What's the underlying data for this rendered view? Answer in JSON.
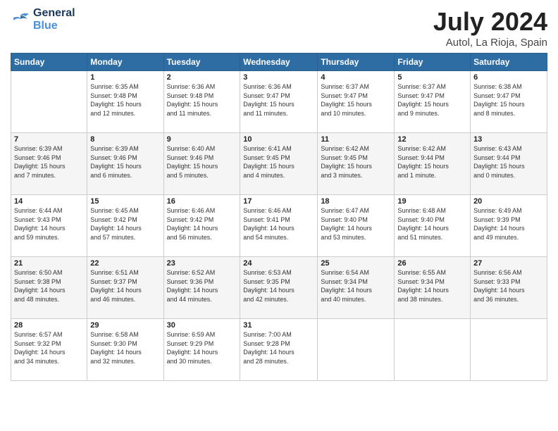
{
  "header": {
    "logo_line1": "General",
    "logo_line2": "Blue",
    "month": "July 2024",
    "location": "Autol, La Rioja, Spain"
  },
  "weekdays": [
    "Sunday",
    "Monday",
    "Tuesday",
    "Wednesday",
    "Thursday",
    "Friday",
    "Saturday"
  ],
  "weeks": [
    [
      {
        "day": "",
        "info": ""
      },
      {
        "day": "1",
        "info": "Sunrise: 6:35 AM\nSunset: 9:48 PM\nDaylight: 15 hours\nand 12 minutes."
      },
      {
        "day": "2",
        "info": "Sunrise: 6:36 AM\nSunset: 9:48 PM\nDaylight: 15 hours\nand 11 minutes."
      },
      {
        "day": "3",
        "info": "Sunrise: 6:36 AM\nSunset: 9:47 PM\nDaylight: 15 hours\nand 11 minutes."
      },
      {
        "day": "4",
        "info": "Sunrise: 6:37 AM\nSunset: 9:47 PM\nDaylight: 15 hours\nand 10 minutes."
      },
      {
        "day": "5",
        "info": "Sunrise: 6:37 AM\nSunset: 9:47 PM\nDaylight: 15 hours\nand 9 minutes."
      },
      {
        "day": "6",
        "info": "Sunrise: 6:38 AM\nSunset: 9:47 PM\nDaylight: 15 hours\nand 8 minutes."
      }
    ],
    [
      {
        "day": "7",
        "info": "Sunrise: 6:39 AM\nSunset: 9:46 PM\nDaylight: 15 hours\nand 7 minutes."
      },
      {
        "day": "8",
        "info": "Sunrise: 6:39 AM\nSunset: 9:46 PM\nDaylight: 15 hours\nand 6 minutes."
      },
      {
        "day": "9",
        "info": "Sunrise: 6:40 AM\nSunset: 9:46 PM\nDaylight: 15 hours\nand 5 minutes."
      },
      {
        "day": "10",
        "info": "Sunrise: 6:41 AM\nSunset: 9:45 PM\nDaylight: 15 hours\nand 4 minutes."
      },
      {
        "day": "11",
        "info": "Sunrise: 6:42 AM\nSunset: 9:45 PM\nDaylight: 15 hours\nand 3 minutes."
      },
      {
        "day": "12",
        "info": "Sunrise: 6:42 AM\nSunset: 9:44 PM\nDaylight: 15 hours\nand 1 minute."
      },
      {
        "day": "13",
        "info": "Sunrise: 6:43 AM\nSunset: 9:44 PM\nDaylight: 15 hours\nand 0 minutes."
      }
    ],
    [
      {
        "day": "14",
        "info": "Sunrise: 6:44 AM\nSunset: 9:43 PM\nDaylight: 14 hours\nand 59 minutes."
      },
      {
        "day": "15",
        "info": "Sunrise: 6:45 AM\nSunset: 9:42 PM\nDaylight: 14 hours\nand 57 minutes."
      },
      {
        "day": "16",
        "info": "Sunrise: 6:46 AM\nSunset: 9:42 PM\nDaylight: 14 hours\nand 56 minutes."
      },
      {
        "day": "17",
        "info": "Sunrise: 6:46 AM\nSunset: 9:41 PM\nDaylight: 14 hours\nand 54 minutes."
      },
      {
        "day": "18",
        "info": "Sunrise: 6:47 AM\nSunset: 9:40 PM\nDaylight: 14 hours\nand 53 minutes."
      },
      {
        "day": "19",
        "info": "Sunrise: 6:48 AM\nSunset: 9:40 PM\nDaylight: 14 hours\nand 51 minutes."
      },
      {
        "day": "20",
        "info": "Sunrise: 6:49 AM\nSunset: 9:39 PM\nDaylight: 14 hours\nand 49 minutes."
      }
    ],
    [
      {
        "day": "21",
        "info": "Sunrise: 6:50 AM\nSunset: 9:38 PM\nDaylight: 14 hours\nand 48 minutes."
      },
      {
        "day": "22",
        "info": "Sunrise: 6:51 AM\nSunset: 9:37 PM\nDaylight: 14 hours\nand 46 minutes."
      },
      {
        "day": "23",
        "info": "Sunrise: 6:52 AM\nSunset: 9:36 PM\nDaylight: 14 hours\nand 44 minutes."
      },
      {
        "day": "24",
        "info": "Sunrise: 6:53 AM\nSunset: 9:35 PM\nDaylight: 14 hours\nand 42 minutes."
      },
      {
        "day": "25",
        "info": "Sunrise: 6:54 AM\nSunset: 9:34 PM\nDaylight: 14 hours\nand 40 minutes."
      },
      {
        "day": "26",
        "info": "Sunrise: 6:55 AM\nSunset: 9:34 PM\nDaylight: 14 hours\nand 38 minutes."
      },
      {
        "day": "27",
        "info": "Sunrise: 6:56 AM\nSunset: 9:33 PM\nDaylight: 14 hours\nand 36 minutes."
      }
    ],
    [
      {
        "day": "28",
        "info": "Sunrise: 6:57 AM\nSunset: 9:32 PM\nDaylight: 14 hours\nand 34 minutes."
      },
      {
        "day": "29",
        "info": "Sunrise: 6:58 AM\nSunset: 9:30 PM\nDaylight: 14 hours\nand 32 minutes."
      },
      {
        "day": "30",
        "info": "Sunrise: 6:59 AM\nSunset: 9:29 PM\nDaylight: 14 hours\nand 30 minutes."
      },
      {
        "day": "31",
        "info": "Sunrise: 7:00 AM\nSunset: 9:28 PM\nDaylight: 14 hours\nand 28 minutes."
      },
      {
        "day": "",
        "info": ""
      },
      {
        "day": "",
        "info": ""
      },
      {
        "day": "",
        "info": ""
      }
    ]
  ]
}
